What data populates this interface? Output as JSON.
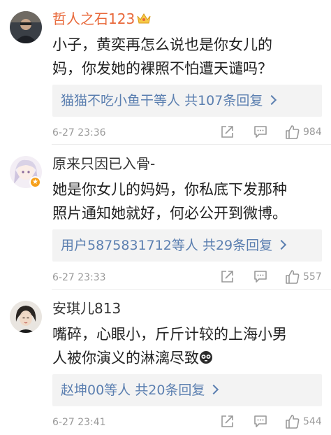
{
  "comments": [
    {
      "username": "哲人之石123",
      "lines": [
        "小子，黄奕再怎么说也是你女儿的",
        "妈，你发她的裸照不怕遭天谴吗？"
      ],
      "replies": {
        "who": "猫猫不吃小鱼干等人",
        "total": "共107条回复"
      },
      "time": "6-27 23:36",
      "likes": "984"
    },
    {
      "username": "原来只因已入骨-",
      "lines": [
        "她是你女儿的妈妈，你私底下发那种",
        "照片通知她就好，何必公开到微博。"
      ],
      "replies": {
        "who": "用户5875831712等人",
        "total": "共29条回复"
      },
      "time": "6-27 23:33",
      "likes": "557"
    },
    {
      "username": "安琪儿813",
      "lines": [
        "嘴碎，心眼小，斤斤计较的上海小男",
        "人被你演义的淋漓尽致"
      ],
      "replies": {
        "who": "赵坤00等人",
        "total": "共20条回复"
      },
      "time": "6-27 23:41",
      "likes": "544"
    }
  ]
}
